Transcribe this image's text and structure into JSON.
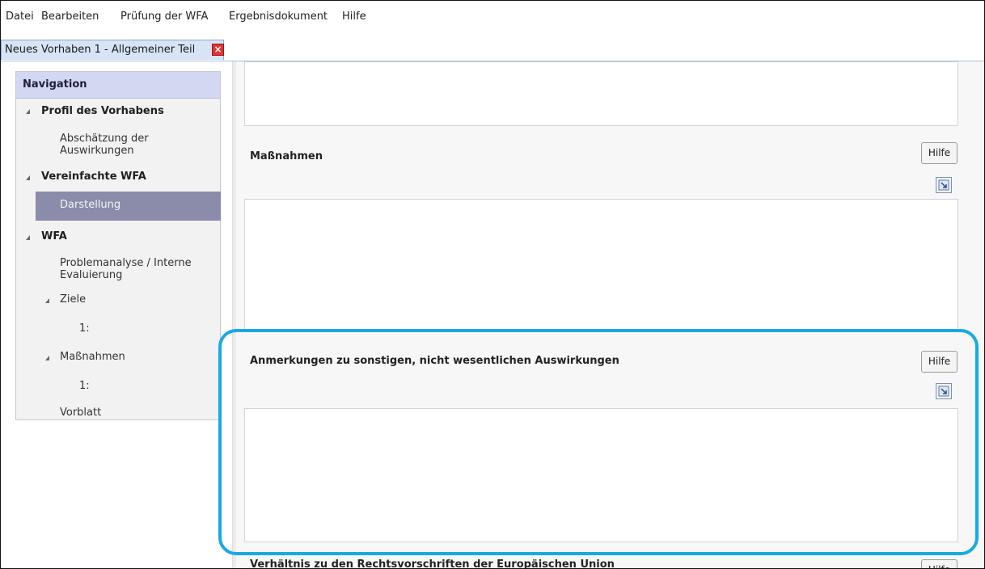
{
  "menu": {
    "items": [
      "Datei",
      "Bearbeiten",
      "Prüfung der WFA",
      "Ergebnisdokument",
      "Hilfe"
    ]
  },
  "tabs": [
    {
      "label": "Neues Vorhaben 1 - Allgemeiner Teil",
      "close_icon": "close-icon"
    }
  ],
  "navigation": {
    "title": "Navigation",
    "profil": "Profil des Vorhabens",
    "abschaetzung_line1": "Abschätzung der",
    "abschaetzung_line2": "Auswirkungen",
    "vereinfachte": "Vereinfachte WFA",
    "darstellung": "Darstellung",
    "wfa": "WFA",
    "problem_line1": "Problemanalyse / Interne",
    "problem_line2": "Evaluierung",
    "ziele": "Ziele",
    "ziele_1": "1:",
    "massnahmen": "Maßnahmen",
    "massnahmen_1": "1:",
    "vorblatt": "Vorblatt"
  },
  "content": {
    "sections": [
      {
        "title": "Maßnahmen",
        "help_label": "Hilfe"
      },
      {
        "title": "Anmerkungen zu sonstigen, nicht wesentlichen Auswirkungen",
        "help_label": "Hilfe"
      },
      {
        "title": "Verhältnis zu den Rechtsvorschriften der Europäischen Union",
        "help_label": "Hilfe"
      }
    ]
  },
  "colors": {
    "highlight": "#19a9e1",
    "nav_header": "#d3d7f1",
    "nav_selected": "#8a8ca9",
    "tab_bg": "#d6e4f5",
    "close_red": "#e53232"
  }
}
